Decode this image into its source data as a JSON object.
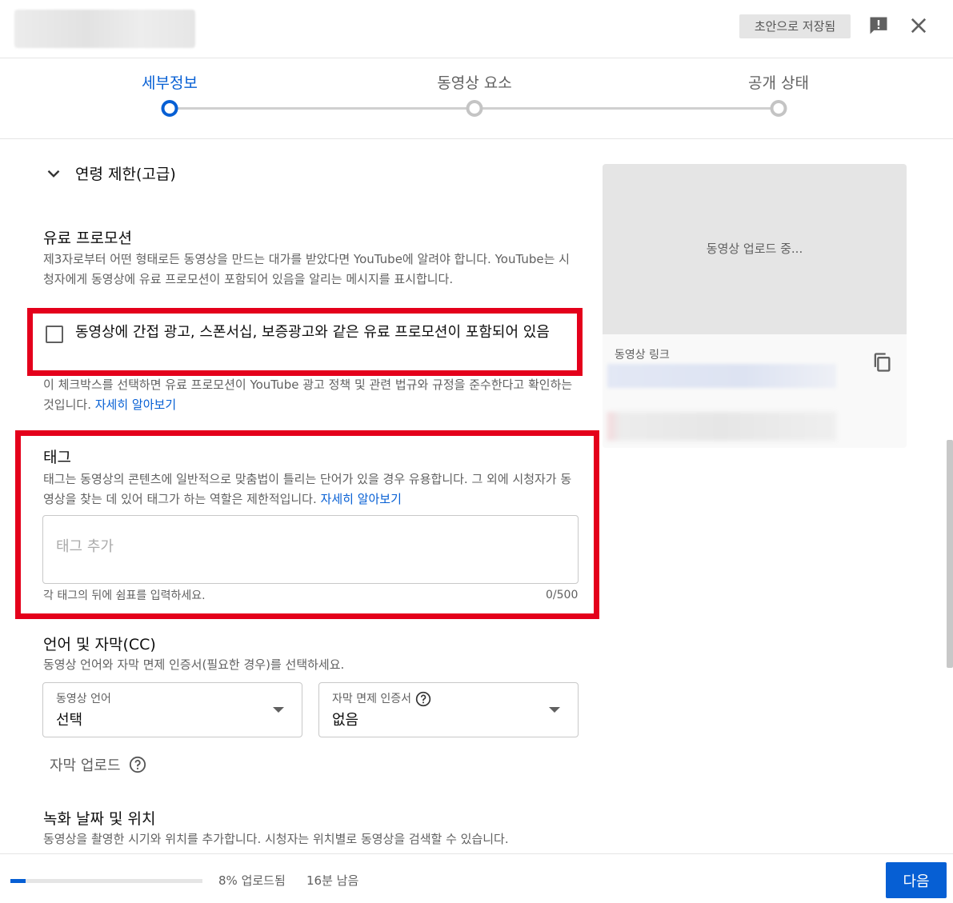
{
  "header": {
    "draft_status": "초안으로 저장됨"
  },
  "stepper": {
    "steps": [
      {
        "label": "세부정보",
        "active": true
      },
      {
        "label": "동영상 요소",
        "active": false
      },
      {
        "label": "공개 상태",
        "active": false
      }
    ]
  },
  "age_restriction": {
    "label": "연령 제한(고급)"
  },
  "paid_promotion": {
    "title": "유료 프로모션",
    "description": "제3자로부터 어떤 형태로든 동영상을 만드는 대가를 받았다면 YouTube에 알려야 합니다. YouTube는 시청자에게 동영상에 유료 프로모션이 포함되어 있음을 알리는 메시지를 표시합니다.",
    "checkbox_label": "동영상에 간접 광고, 스폰서십, 보증광고와 같은 유료 프로모션이 포함되어 있음",
    "checkbox_checked": false,
    "note": "이 체크박스를 선택하면 유료 프로모션이 YouTube 광고 정책 및 관련 법규와 규정을 준수한다고 확인하는 것입니다.",
    "learn_more": "자세히 알아보기"
  },
  "tags": {
    "title": "태그",
    "description": "태그는 동영상의 콘텐츠에 일반적으로 맞춤법이 틀리는 단어가 있을 경우 유용합니다. 그 외에 시청자가 동영상을 찾는 데 있어 태그가 하는 역할은 제한적입니다.",
    "learn_more": "자세히 알아보기",
    "placeholder": "태그 추가",
    "hint": "각 태그의 뒤에 쉼표를 입력하세요.",
    "counter": "0/500"
  },
  "language": {
    "title": "언어 및 자막(CC)",
    "description": "동영상 언어와 자막 면제 인증서(필요한 경우)를 선택하세요.",
    "video_language_label": "동영상 언어",
    "video_language_value": "선택",
    "caption_cert_label": "자막 면제 인증서",
    "caption_cert_value": "없음",
    "upload_captions": "자막 업로드"
  },
  "recording": {
    "title": "녹화 날짜 및 위치",
    "description": "동영상을 촬영한 시기와 위치를 추가합니다. 시청자는 위치별로 동영상을 검색할 수 있습니다."
  },
  "preview": {
    "status": "동영상 업로드 중...",
    "link_label": "동영상 링크"
  },
  "footer": {
    "progress_percent": 8,
    "progress_text": "8% 업로드됨",
    "time_left": "16분 남음",
    "next_label": "다음"
  },
  "colors": {
    "accent": "#065fd4",
    "highlight": "#e4001b"
  }
}
